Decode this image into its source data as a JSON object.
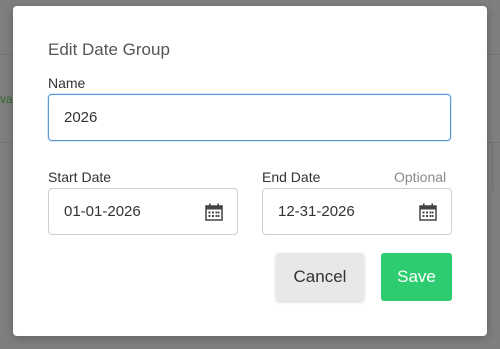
{
  "background": {
    "snippet_text": "va"
  },
  "dialog": {
    "title": "Edit Date Group",
    "name_label": "Name",
    "name_value": "2026",
    "start_label": "Start Date",
    "start_value": "01-01-2026",
    "end_label": "End Date",
    "end_optional": "Optional",
    "end_value": "12-31-2026",
    "cancel_label": "Cancel",
    "save_label": "Save"
  },
  "colors": {
    "save_button": "#2ecc71",
    "focus_border": "#5b9bd5",
    "overlay": "#7f7f7f"
  },
  "icons": {
    "start_date": "calendar-icon",
    "end_date": "calendar-icon"
  }
}
